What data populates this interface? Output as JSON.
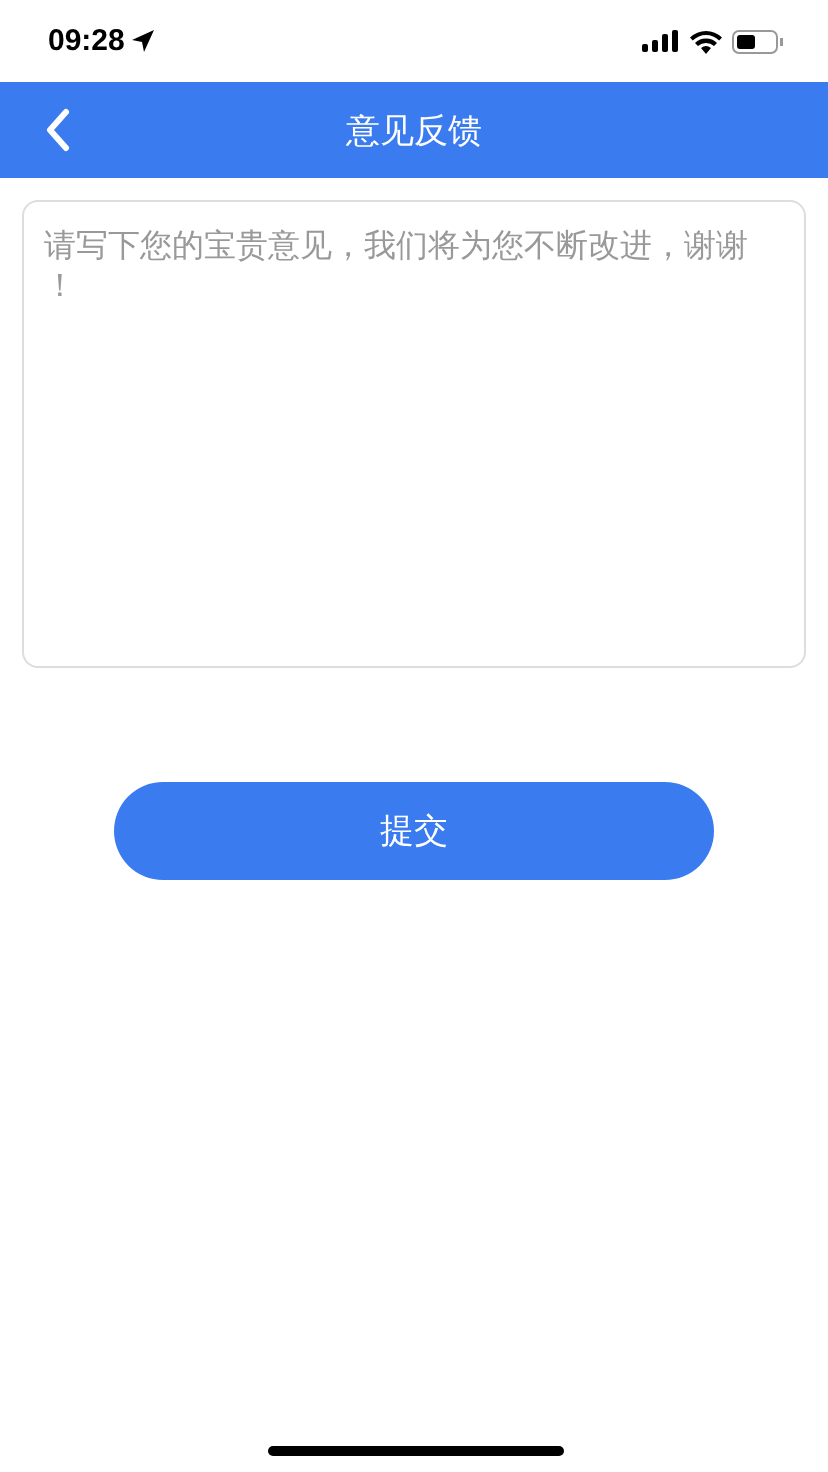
{
  "status_bar": {
    "time": "09:28"
  },
  "nav_bar": {
    "title": "意见反馈"
  },
  "feedback": {
    "placeholder": "请写下您的宝贵意见，我们将为您不断改进，谢谢！"
  },
  "submit_button": {
    "label": "提交"
  }
}
